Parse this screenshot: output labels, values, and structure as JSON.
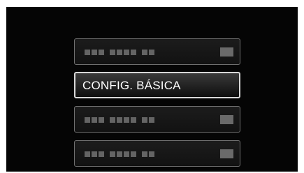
{
  "menu": {
    "items": [
      {
        "state": "disabled",
        "label": ""
      },
      {
        "state": "selected",
        "label": "CONFIG. BÁSICA"
      },
      {
        "state": "disabled",
        "label": ""
      },
      {
        "state": "disabled",
        "label": ""
      }
    ]
  },
  "colors": {
    "screen_background": "#050505",
    "selected_border": "#d8d8d8",
    "dimmed_border": "#6f6f6f",
    "placeholder_block": "#646464",
    "text": "#ffffff"
  }
}
